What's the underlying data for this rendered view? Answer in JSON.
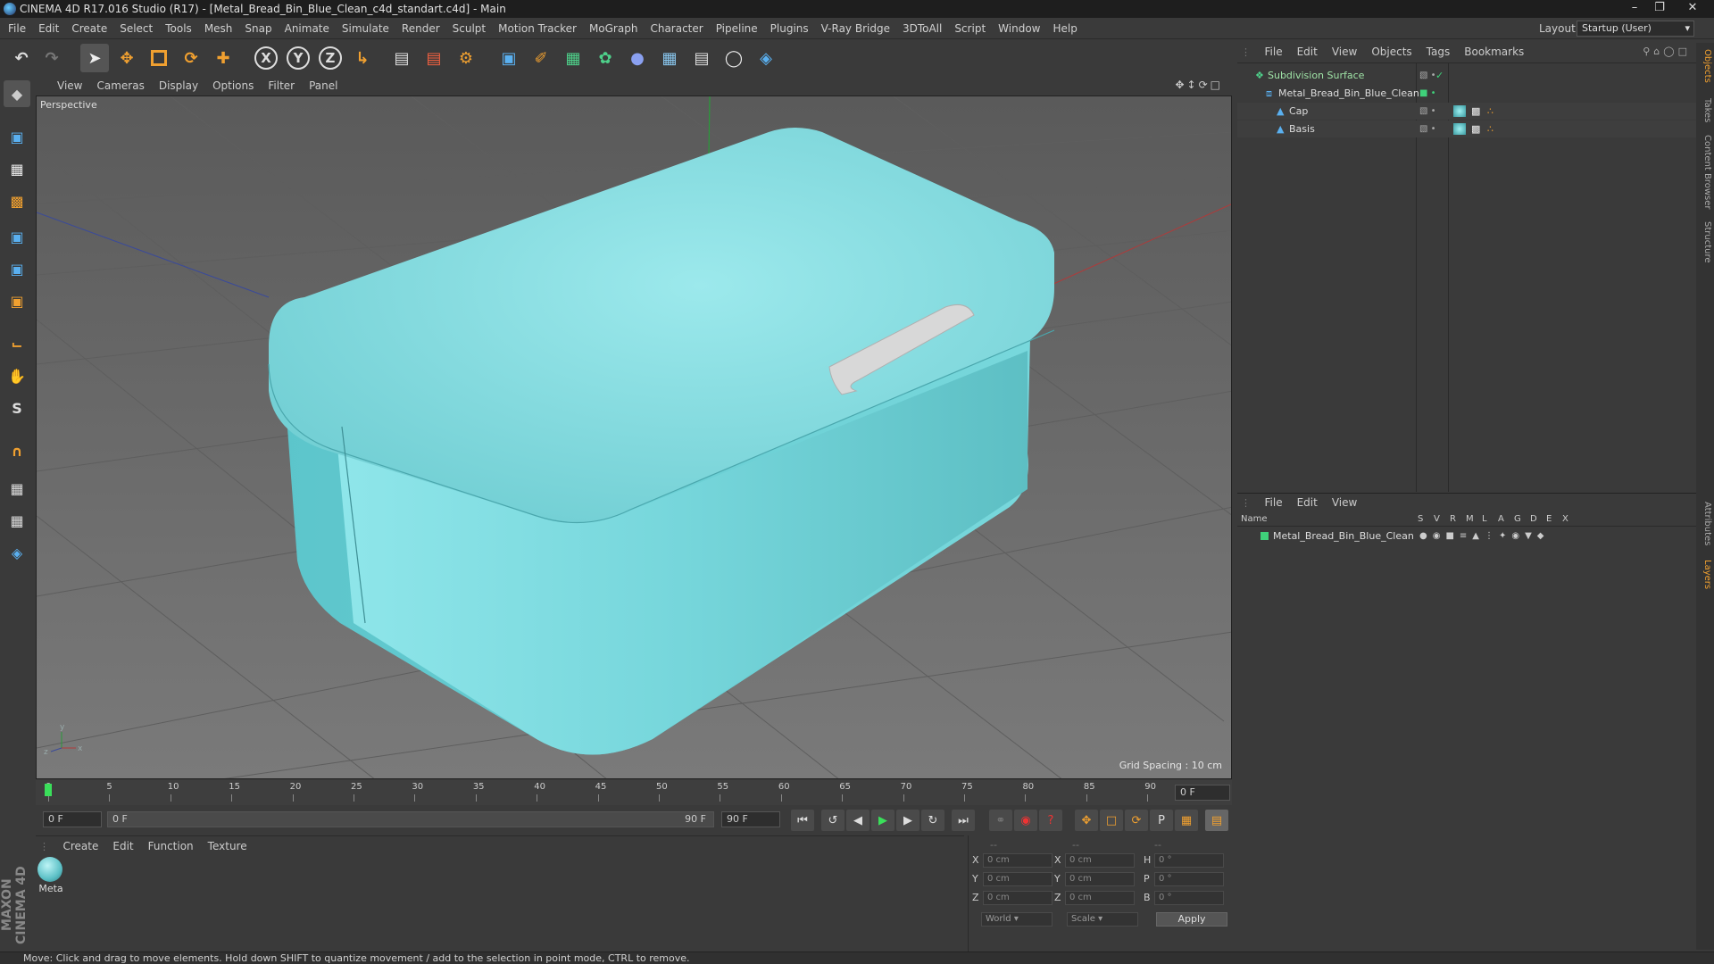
{
  "window": {
    "title": "CINEMA 4D R17.016 Studio (R17) - [Metal_Bread_Bin_Blue_Clean_c4d_standart.c4d] - Main"
  },
  "menubar": {
    "items": [
      "File",
      "Edit",
      "Create",
      "Select",
      "Tools",
      "Mesh",
      "Snap",
      "Animate",
      "Simulate",
      "Render",
      "Sculpt",
      "Motion Tracker",
      "MoGraph",
      "Character",
      "Pipeline",
      "Plugins",
      "V-Ray Bridge",
      "3DToAll",
      "Script",
      "Window",
      "Help"
    ],
    "layout_label": "Layout:",
    "layout_value": "Startup (User)"
  },
  "viewport": {
    "menu": [
      "View",
      "Cameras",
      "Display",
      "Options",
      "Filter",
      "Panel"
    ],
    "camera_label": "Perspective",
    "grid_spacing": "Grid Spacing : 10 cm",
    "colors": {
      "object": "#7ed8dc",
      "background": "#6a6a6a"
    }
  },
  "timeline": {
    "ticks": [
      "0",
      "5",
      "10",
      "15",
      "20",
      "25",
      "30",
      "35",
      "40",
      "45",
      "50",
      "55",
      "60",
      "65",
      "70",
      "75",
      "80",
      "85",
      "90"
    ],
    "current_frame_field": "0 F",
    "start_field": "0 F",
    "range_start": "0 F",
    "range_end": "90 F",
    "end_field": "90 F"
  },
  "material_manager": {
    "menu": [
      "Create",
      "Edit",
      "Function",
      "Texture"
    ],
    "materials": [
      {
        "name": "Meta"
      }
    ]
  },
  "coordinates": {
    "headers": [
      "--",
      "--",
      "--"
    ],
    "rows": [
      {
        "a": "X",
        "av": "0 cm",
        "b": "X",
        "bv": "0 cm",
        "c": "H",
        "cv": "0 °"
      },
      {
        "a": "Y",
        "av": "0 cm",
        "b": "Y",
        "bv": "0 cm",
        "c": "P",
        "cv": "0 °"
      },
      {
        "a": "Z",
        "av": "0 cm",
        "b": "Z",
        "bv": "0 cm",
        "c": "B",
        "cv": "0 °"
      }
    ],
    "mode1": "World",
    "mode2": "Scale",
    "apply": "Apply"
  },
  "object_manager": {
    "menu": [
      "File",
      "Edit",
      "View",
      "Objects",
      "Tags",
      "Bookmarks"
    ],
    "objects": [
      {
        "name": "Subdivision Surface",
        "indent": 0
      },
      {
        "name": "Metal_Bread_Bin_Blue_Clean",
        "indent": 1
      },
      {
        "name": "Cap",
        "indent": 2
      },
      {
        "name": "Basis",
        "indent": 2
      }
    ]
  },
  "layer_manager": {
    "menu": [
      "File",
      "Edit",
      "View"
    ],
    "columns": [
      "Name",
      "S",
      "V",
      "R",
      "M",
      "L",
      "A",
      "G",
      "D",
      "E",
      "X"
    ],
    "layers": [
      {
        "name": "Metal_Bread_Bin_Blue_Clean",
        "color": "#3fd17a"
      }
    ]
  },
  "right_tabs": [
    "Objects",
    "Takes",
    "Content Browser",
    "Structure",
    "Attributes",
    "Layers"
  ],
  "status": {
    "text": "Move: Click and drag to move elements. Hold down SHIFT to quantize movement / add to the selection in point mode, CTRL to remove."
  },
  "branding": {
    "logo_text": "MAXON CINEMA 4D"
  }
}
